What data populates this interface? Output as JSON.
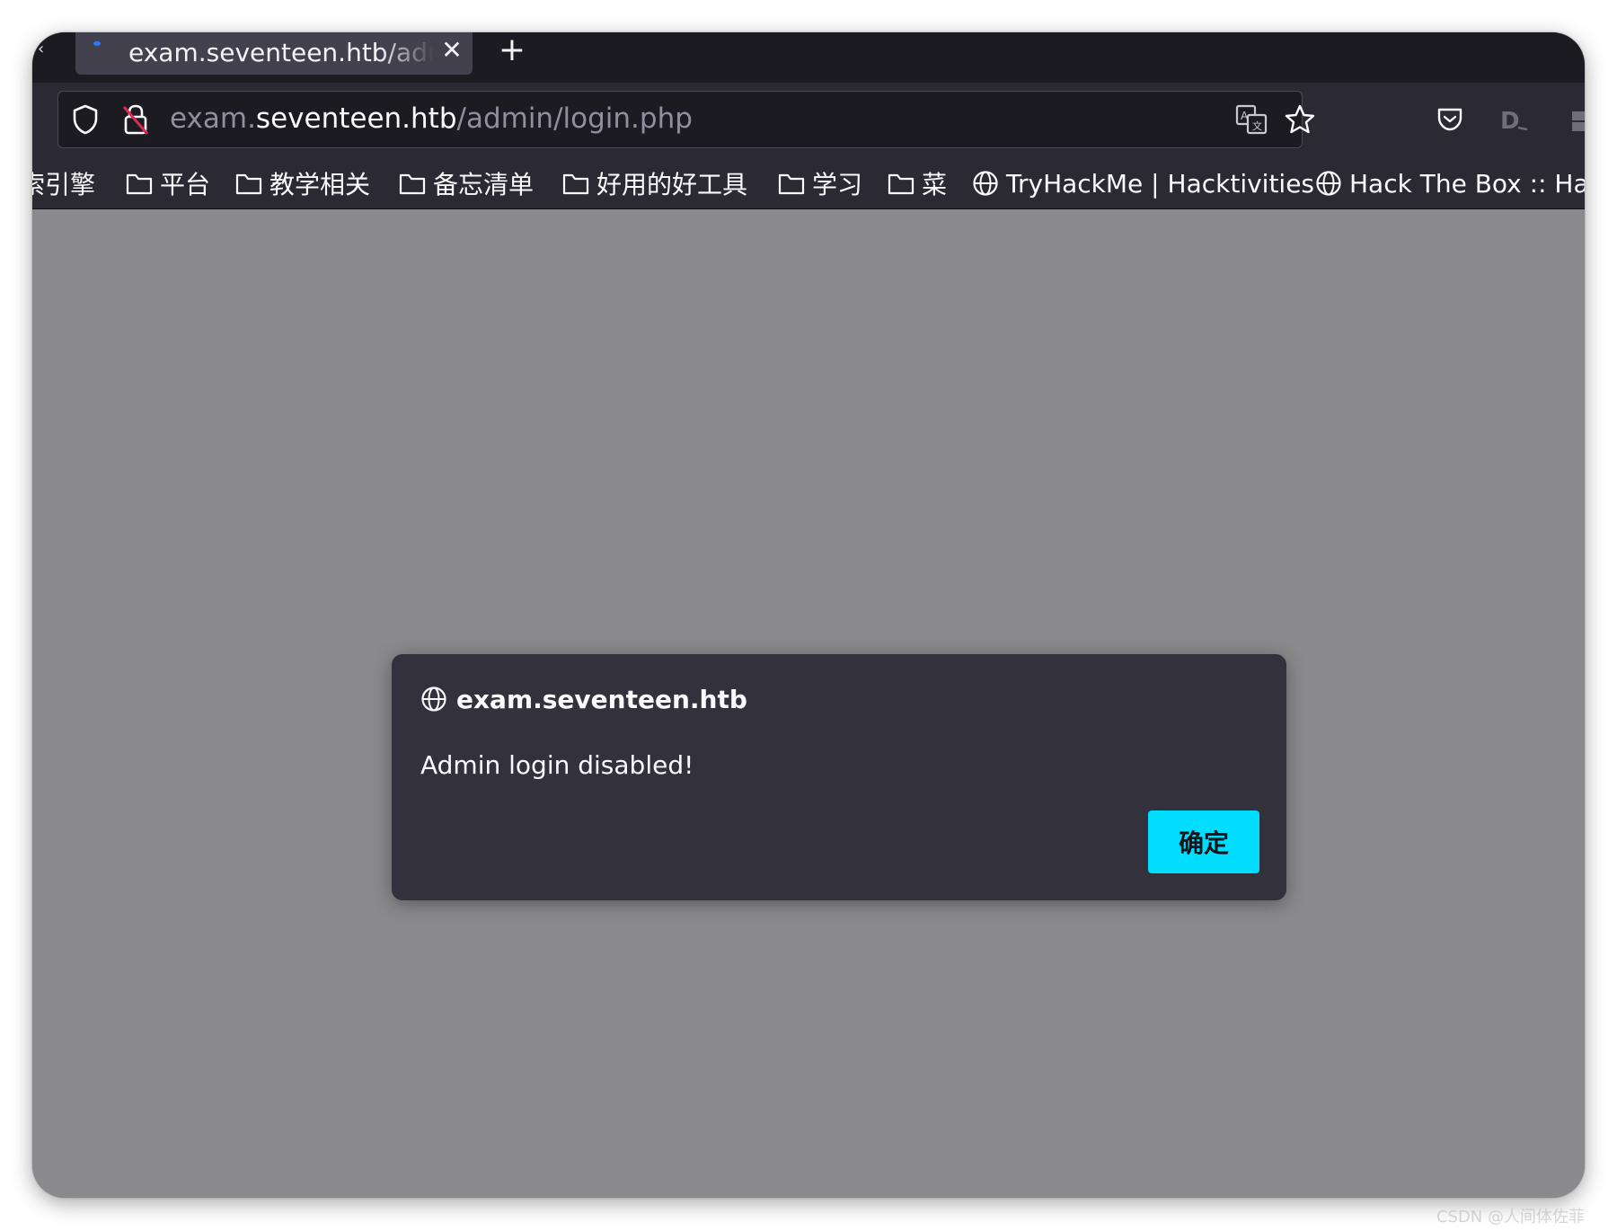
{
  "tab": {
    "title": "exam.seventeen.htb/admin/login.php",
    "close_glyph": "✕",
    "new_tab_glyph": "+"
  },
  "address_bar": {
    "url_prefix": "exam.",
    "url_host": "seventeen.htb",
    "url_path": "/admin/login.php"
  },
  "bookmarks": [
    {
      "icon": "folder-icon",
      "label": "搜索引擎"
    },
    {
      "icon": "folder-icon",
      "label": "平台"
    },
    {
      "icon": "folder-icon",
      "label": "教学相关"
    },
    {
      "icon": "folder-icon",
      "label": "备忘清单"
    },
    {
      "icon": "folder-icon",
      "label": "好用的好工具"
    },
    {
      "icon": "folder-icon",
      "label": "学习"
    },
    {
      "icon": "folder-icon",
      "label": "菜"
    },
    {
      "icon": "globe-icon",
      "label": "TryHackMe | Hacktivities"
    },
    {
      "icon": "globe-icon",
      "label": "Hack The Box :: Hack The Box"
    }
  ],
  "dialog": {
    "host": "exam.seventeen.htb",
    "message": "Admin login disabled!",
    "ok_label": "确定"
  },
  "watermark": "CSDN @人间体佐菲",
  "colors": {
    "accent_button": "#00ddff",
    "dialog_bg": "#32313c",
    "content_overlay": "#8a8a8d",
    "toolbar_bg": "#2b2a33"
  }
}
